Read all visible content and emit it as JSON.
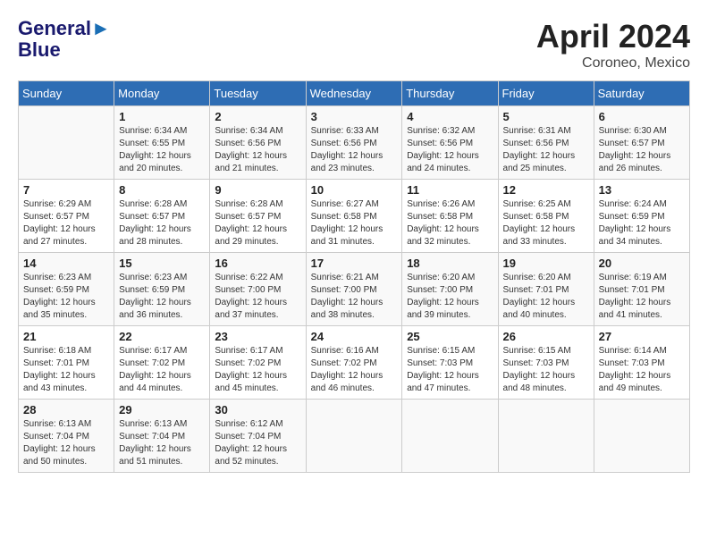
{
  "header": {
    "logo_line1": "General",
    "logo_line2": "Blue",
    "month": "April 2024",
    "location": "Coroneo, Mexico"
  },
  "weekdays": [
    "Sunday",
    "Monday",
    "Tuesday",
    "Wednesday",
    "Thursday",
    "Friday",
    "Saturday"
  ],
  "weeks": [
    [
      {
        "day": "",
        "info": ""
      },
      {
        "day": "1",
        "info": "Sunrise: 6:34 AM\nSunset: 6:55 PM\nDaylight: 12 hours\nand 20 minutes."
      },
      {
        "day": "2",
        "info": "Sunrise: 6:34 AM\nSunset: 6:56 PM\nDaylight: 12 hours\nand 21 minutes."
      },
      {
        "day": "3",
        "info": "Sunrise: 6:33 AM\nSunset: 6:56 PM\nDaylight: 12 hours\nand 23 minutes."
      },
      {
        "day": "4",
        "info": "Sunrise: 6:32 AM\nSunset: 6:56 PM\nDaylight: 12 hours\nand 24 minutes."
      },
      {
        "day": "5",
        "info": "Sunrise: 6:31 AM\nSunset: 6:56 PM\nDaylight: 12 hours\nand 25 minutes."
      },
      {
        "day": "6",
        "info": "Sunrise: 6:30 AM\nSunset: 6:57 PM\nDaylight: 12 hours\nand 26 minutes."
      }
    ],
    [
      {
        "day": "7",
        "info": "Sunrise: 6:29 AM\nSunset: 6:57 PM\nDaylight: 12 hours\nand 27 minutes."
      },
      {
        "day": "8",
        "info": "Sunrise: 6:28 AM\nSunset: 6:57 PM\nDaylight: 12 hours\nand 28 minutes."
      },
      {
        "day": "9",
        "info": "Sunrise: 6:28 AM\nSunset: 6:57 PM\nDaylight: 12 hours\nand 29 minutes."
      },
      {
        "day": "10",
        "info": "Sunrise: 6:27 AM\nSunset: 6:58 PM\nDaylight: 12 hours\nand 31 minutes."
      },
      {
        "day": "11",
        "info": "Sunrise: 6:26 AM\nSunset: 6:58 PM\nDaylight: 12 hours\nand 32 minutes."
      },
      {
        "day": "12",
        "info": "Sunrise: 6:25 AM\nSunset: 6:58 PM\nDaylight: 12 hours\nand 33 minutes."
      },
      {
        "day": "13",
        "info": "Sunrise: 6:24 AM\nSunset: 6:59 PM\nDaylight: 12 hours\nand 34 minutes."
      }
    ],
    [
      {
        "day": "14",
        "info": "Sunrise: 6:23 AM\nSunset: 6:59 PM\nDaylight: 12 hours\nand 35 minutes."
      },
      {
        "day": "15",
        "info": "Sunrise: 6:23 AM\nSunset: 6:59 PM\nDaylight: 12 hours\nand 36 minutes."
      },
      {
        "day": "16",
        "info": "Sunrise: 6:22 AM\nSunset: 7:00 PM\nDaylight: 12 hours\nand 37 minutes."
      },
      {
        "day": "17",
        "info": "Sunrise: 6:21 AM\nSunset: 7:00 PM\nDaylight: 12 hours\nand 38 minutes."
      },
      {
        "day": "18",
        "info": "Sunrise: 6:20 AM\nSunset: 7:00 PM\nDaylight: 12 hours\nand 39 minutes."
      },
      {
        "day": "19",
        "info": "Sunrise: 6:20 AM\nSunset: 7:01 PM\nDaylight: 12 hours\nand 40 minutes."
      },
      {
        "day": "20",
        "info": "Sunrise: 6:19 AM\nSunset: 7:01 PM\nDaylight: 12 hours\nand 41 minutes."
      }
    ],
    [
      {
        "day": "21",
        "info": "Sunrise: 6:18 AM\nSunset: 7:01 PM\nDaylight: 12 hours\nand 43 minutes."
      },
      {
        "day": "22",
        "info": "Sunrise: 6:17 AM\nSunset: 7:02 PM\nDaylight: 12 hours\nand 44 minutes."
      },
      {
        "day": "23",
        "info": "Sunrise: 6:17 AM\nSunset: 7:02 PM\nDaylight: 12 hours\nand 45 minutes."
      },
      {
        "day": "24",
        "info": "Sunrise: 6:16 AM\nSunset: 7:02 PM\nDaylight: 12 hours\nand 46 minutes."
      },
      {
        "day": "25",
        "info": "Sunrise: 6:15 AM\nSunset: 7:03 PM\nDaylight: 12 hours\nand 47 minutes."
      },
      {
        "day": "26",
        "info": "Sunrise: 6:15 AM\nSunset: 7:03 PM\nDaylight: 12 hours\nand 48 minutes."
      },
      {
        "day": "27",
        "info": "Sunrise: 6:14 AM\nSunset: 7:03 PM\nDaylight: 12 hours\nand 49 minutes."
      }
    ],
    [
      {
        "day": "28",
        "info": "Sunrise: 6:13 AM\nSunset: 7:04 PM\nDaylight: 12 hours\nand 50 minutes."
      },
      {
        "day": "29",
        "info": "Sunrise: 6:13 AM\nSunset: 7:04 PM\nDaylight: 12 hours\nand 51 minutes."
      },
      {
        "day": "30",
        "info": "Sunrise: 6:12 AM\nSunset: 7:04 PM\nDaylight: 12 hours\nand 52 minutes."
      },
      {
        "day": "",
        "info": ""
      },
      {
        "day": "",
        "info": ""
      },
      {
        "day": "",
        "info": ""
      },
      {
        "day": "",
        "info": ""
      }
    ]
  ]
}
